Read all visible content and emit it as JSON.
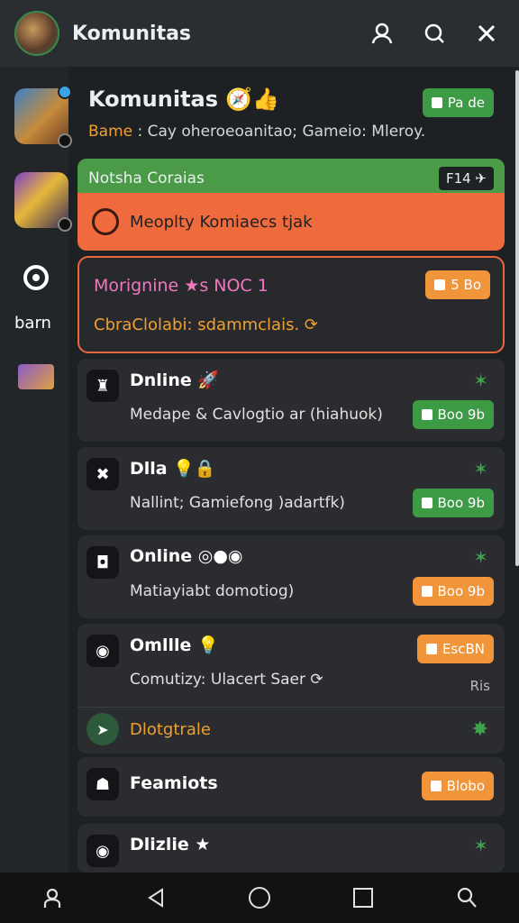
{
  "topbar": {
    "title": "Komunitas",
    "icons": [
      "profile-icon",
      "search-icon",
      "close-icon"
    ]
  },
  "sidebar": {
    "label": "barn"
  },
  "header": {
    "title": "Komunitas",
    "subtitle_key": "Bame",
    "subtitle_text": " : Cay oheroeoanitao; Gameio: Mleroy.",
    "pill": "Pa de"
  },
  "banner": {
    "green_text": "Notsha Coraias",
    "green_badge": "F14",
    "orange_text": "Meoplty Komiaecs tjak"
  },
  "featured": {
    "title": "Morignine",
    "title_suffix": "s NOC 1",
    "pill": "5 Bo",
    "subtitle": "CbraClolabi: sdammclais."
  },
  "cards": [
    {
      "name": "Dnline",
      "desc": "Medape & Cavlogtio ar (hiahuok)",
      "pill": "Boo 9b",
      "pill_color": "green"
    },
    {
      "name": "Dlla",
      "desc": "Nallint; Gamiefong )adartfk)",
      "pill": "Boo 9b",
      "pill_color": "green"
    },
    {
      "name": "Online",
      "desc": "Matiayiabt domotiog)",
      "pill": "Boo 9b",
      "pill_color": "orange"
    },
    {
      "name": "Omllle",
      "desc": "Comutizy: Ulacert Saer",
      "pill": "EscBN",
      "pill_color": "orange",
      "side": "Ris",
      "row2": "Dlotgtrale"
    },
    {
      "name": "Feamiots",
      "pill": "Blobo",
      "pill_color": "orange"
    },
    {
      "name": "Dlizlie"
    }
  ],
  "navbar": [
    "person-icon",
    "back-icon",
    "home-icon",
    "recents-icon",
    "search-icon"
  ]
}
